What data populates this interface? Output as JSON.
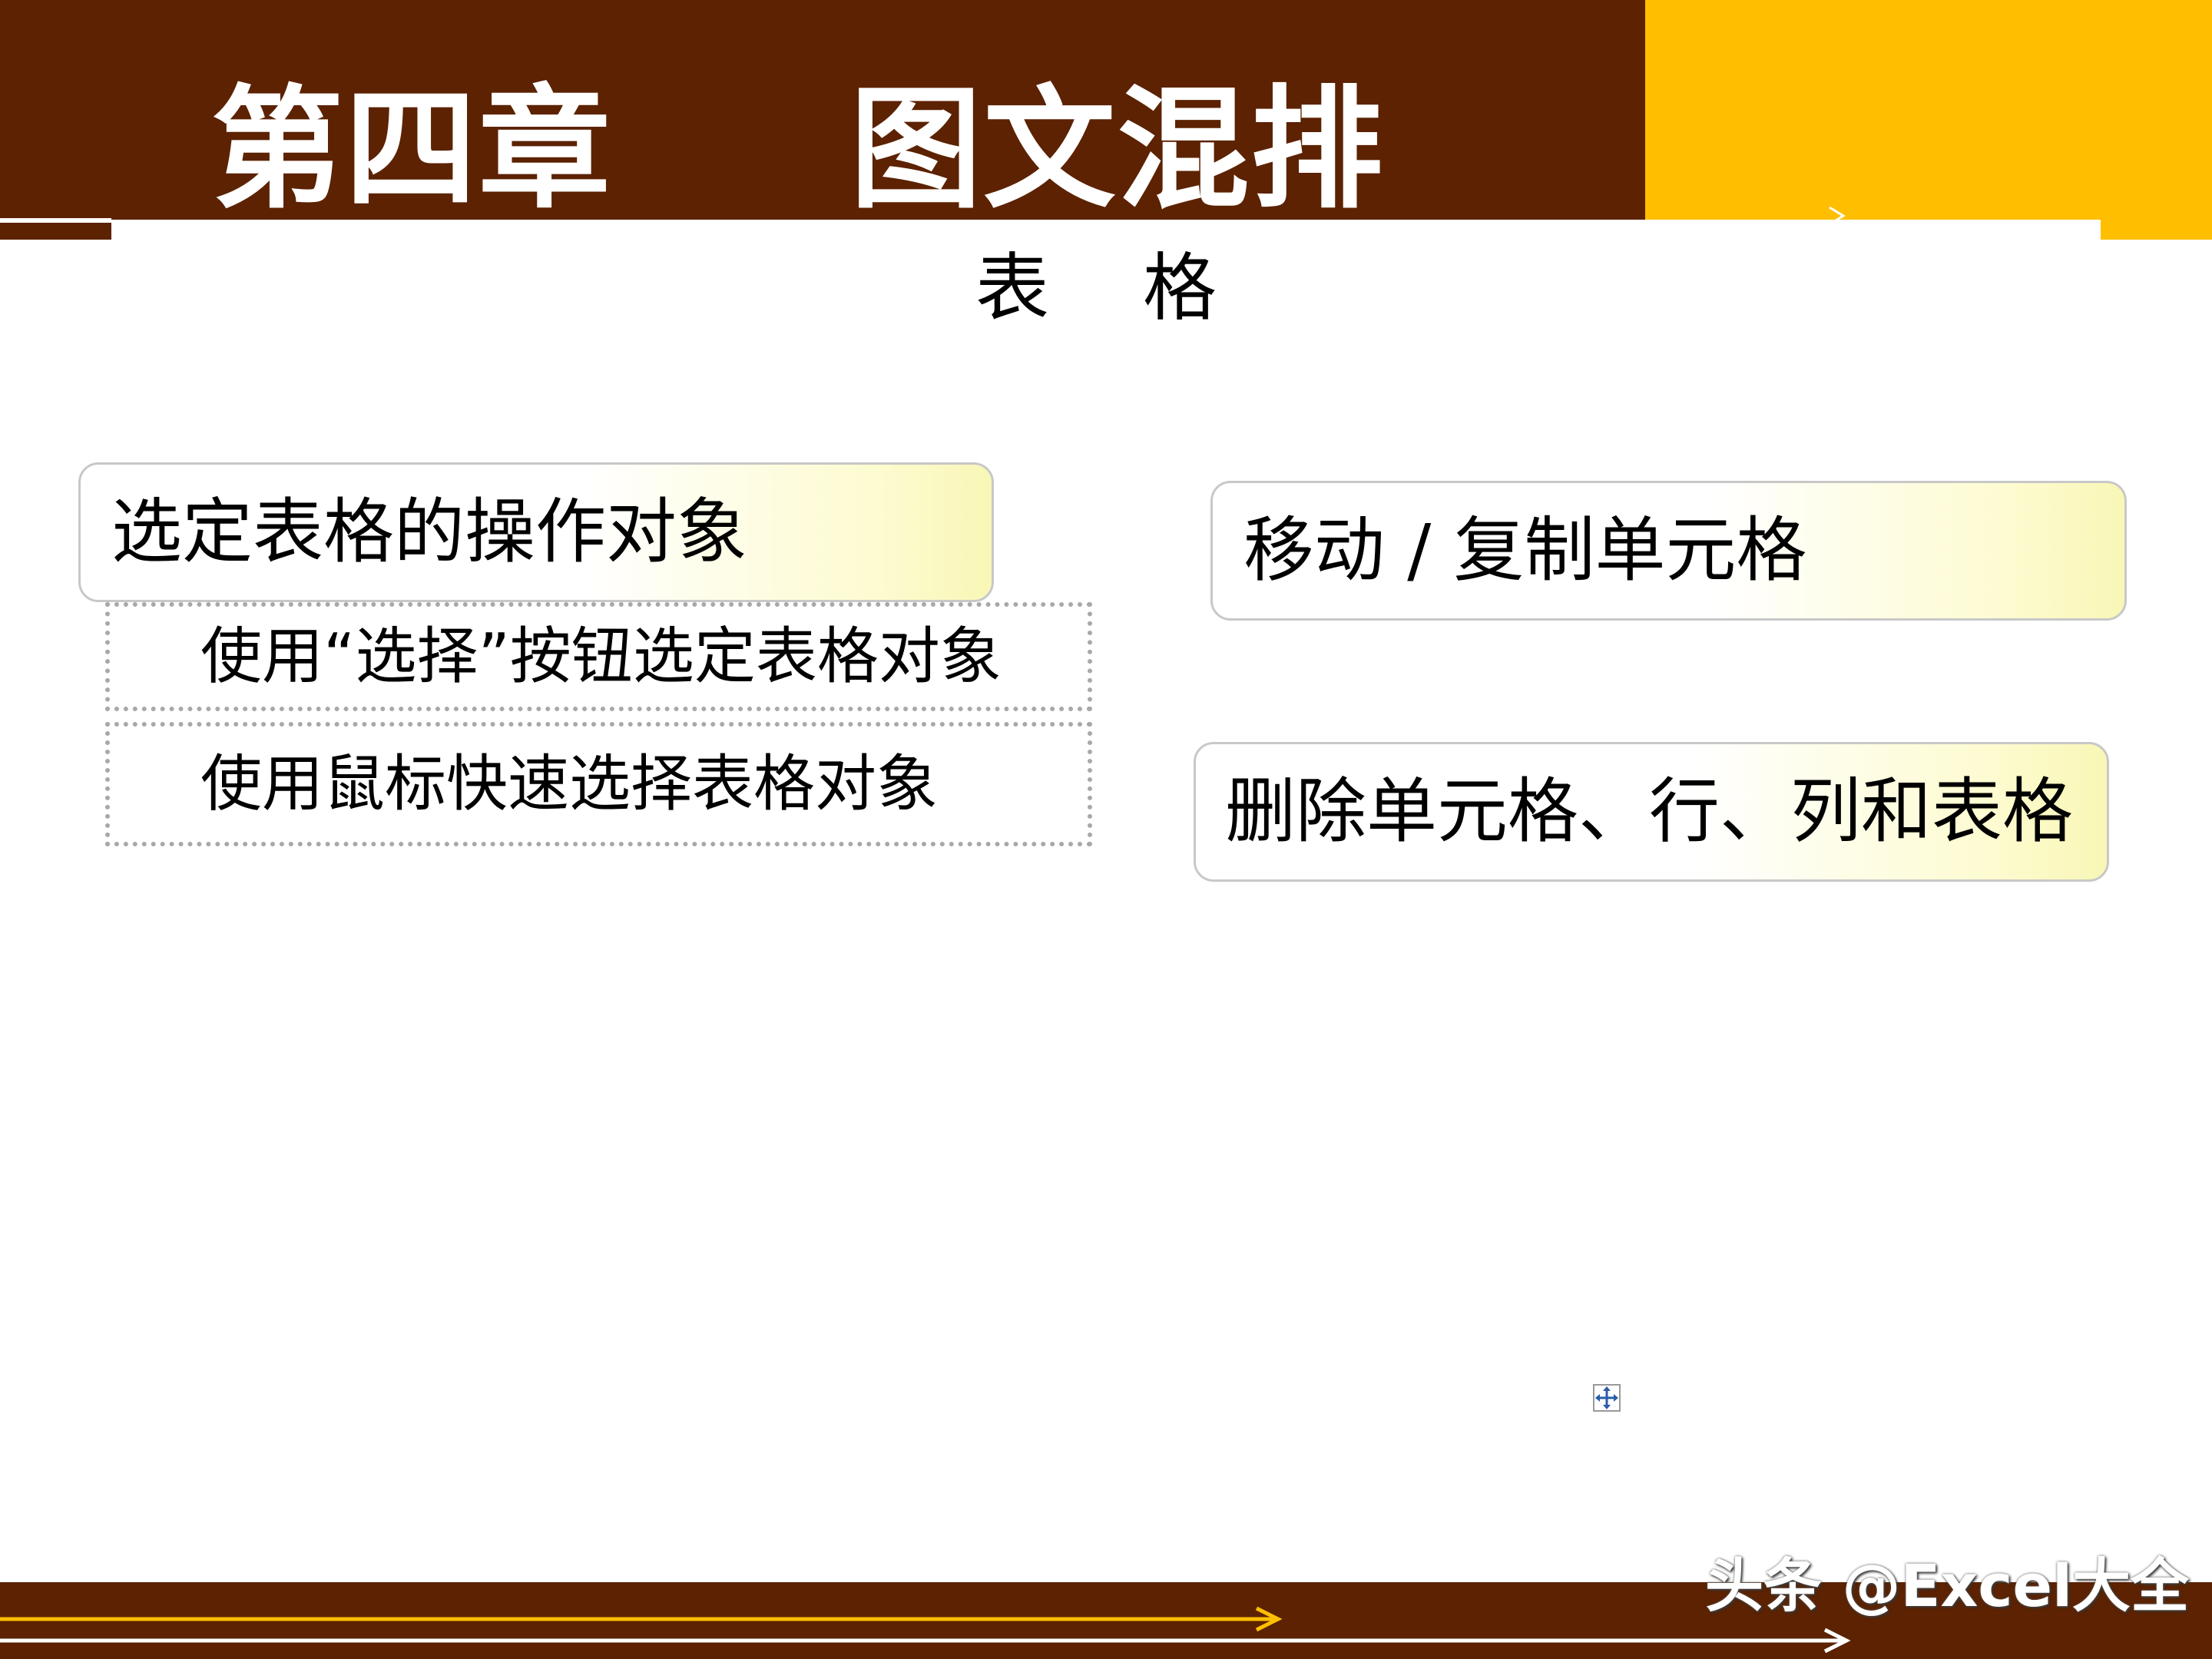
{
  "header": {
    "chapter_title": "第四章     图文混排"
  },
  "section": {
    "title": "表    格"
  },
  "boxes": {
    "select_object": "选定表格的操作对象",
    "move_copy_cells": "移动 / 复制单元格",
    "delete_cells": "删除单元格、行、列和表格"
  },
  "sub_items": {
    "use_select_button": "使用“选择”按钮选定表格对象",
    "use_mouse": "使用鼠标快速选择表格对象"
  },
  "footer": {
    "watermark": "头条 @Excel大全"
  },
  "colors": {
    "brown": "#5c2201",
    "gold": "#ffbf00"
  },
  "icons": {
    "move_handle": "move-handle-icon"
  }
}
